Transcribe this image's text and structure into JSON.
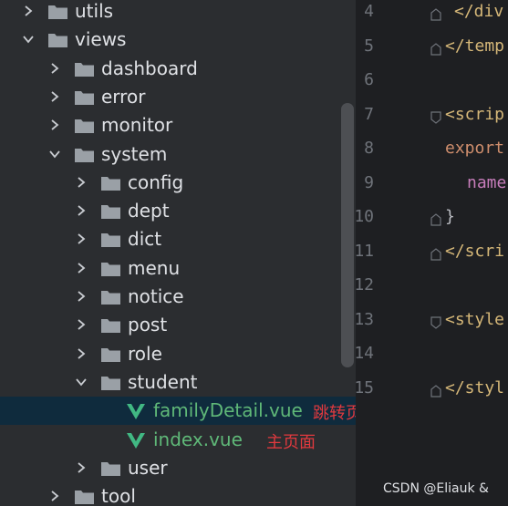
{
  "tree": {
    "items": [
      {
        "label": "utils",
        "type": "folder",
        "expanded": false
      },
      {
        "label": "views",
        "type": "folder",
        "expanded": true
      },
      {
        "label": "dashboard",
        "type": "folder",
        "expanded": false
      },
      {
        "label": "error",
        "type": "folder",
        "expanded": false
      },
      {
        "label": "monitor",
        "type": "folder",
        "expanded": false
      },
      {
        "label": "system",
        "type": "folder",
        "expanded": true
      },
      {
        "label": "config",
        "type": "folder",
        "expanded": false
      },
      {
        "label": "dept",
        "type": "folder",
        "expanded": false
      },
      {
        "label": "dict",
        "type": "folder",
        "expanded": false
      },
      {
        "label": "menu",
        "type": "folder",
        "expanded": false
      },
      {
        "label": "notice",
        "type": "folder",
        "expanded": false
      },
      {
        "label": "post",
        "type": "folder",
        "expanded": false
      },
      {
        "label": "role",
        "type": "folder",
        "expanded": false
      },
      {
        "label": "student",
        "type": "folder",
        "expanded": true
      },
      {
        "label": "familyDetail.vue",
        "type": "vue",
        "note": "跳转页面",
        "selected": true
      },
      {
        "label": "index.vue",
        "type": "vue",
        "note": "主页面"
      },
      {
        "label": "user",
        "type": "folder",
        "expanded": false
      },
      {
        "label": "tool",
        "type": "folder",
        "expanded": false
      }
    ]
  },
  "editor": {
    "lines": [
      {
        "n": "4",
        "code": "</div"
      },
      {
        "n": "5",
        "code": "</temp"
      },
      {
        "n": "6",
        "code": ""
      },
      {
        "n": "7",
        "code": "<scrip"
      },
      {
        "n": "8",
        "code": "export"
      },
      {
        "n": "9",
        "code": "name"
      },
      {
        "n": "10",
        "code": "}"
      },
      {
        "n": "11",
        "code": "</scri"
      },
      {
        "n": "12",
        "code": ""
      },
      {
        "n": "13",
        "code": "<style"
      },
      {
        "n": "14",
        "code": ""
      },
      {
        "n": "15",
        "code": "</styl"
      }
    ]
  },
  "watermark": "CSDN @Eliauk &",
  "colors": {
    "tree_bg": "#2b2d30",
    "editor_bg": "#1e1f22",
    "selected_row": "#0f2b3d",
    "vue_green": "#41b883",
    "note_red": "#e0393e",
    "tag": "#d5b778",
    "keyword": "#cf8e6d"
  }
}
